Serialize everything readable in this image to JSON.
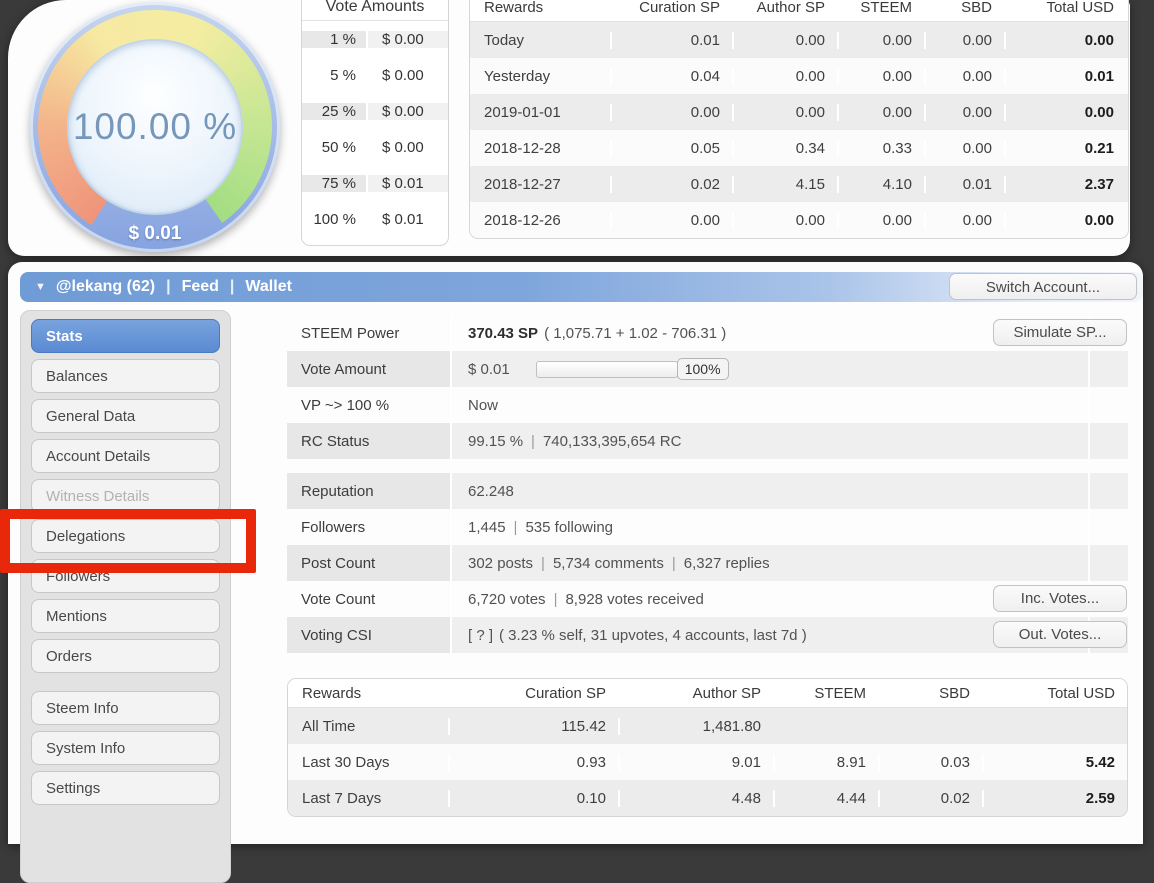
{
  "ui": {
    "sep": "|"
  },
  "gauge": {
    "percent": "100.00 %",
    "amount": "$ 0.01"
  },
  "vote_amounts": {
    "title": "Vote Amounts",
    "rows": [
      {
        "pct": "1 %",
        "value": "$ 0.00"
      },
      {
        "pct": "5 %",
        "value": "$ 0.00"
      },
      {
        "pct": "25 %",
        "value": "$ 0.00"
      },
      {
        "pct": "50 %",
        "value": "$ 0.00"
      },
      {
        "pct": "75 %",
        "value": "$ 0.01"
      },
      {
        "pct": "100 %",
        "value": "$ 0.01"
      }
    ]
  },
  "daily_rewards": {
    "headers": [
      "Rewards",
      "Curation SP",
      "Author SP",
      "STEEM",
      "SBD",
      "Total USD"
    ],
    "rows": [
      {
        "label": "Today",
        "cells": [
          "0.01",
          "0.00",
          "0.00",
          "0.00",
          "0.00"
        ]
      },
      {
        "label": "Yesterday",
        "cells": [
          "0.04",
          "0.00",
          "0.00",
          "0.00",
          "0.01"
        ]
      },
      {
        "label": "2019-01-01",
        "cells": [
          "0.00",
          "0.00",
          "0.00",
          "0.00",
          "0.00"
        ]
      },
      {
        "label": "2018-12-28",
        "cells": [
          "0.05",
          "0.34",
          "0.33",
          "0.00",
          "0.21"
        ]
      },
      {
        "label": "2018-12-27",
        "cells": [
          "0.02",
          "4.15",
          "4.10",
          "0.01",
          "2.37"
        ]
      },
      {
        "label": "2018-12-26",
        "cells": [
          "0.00",
          "0.00",
          "0.00",
          "0.00",
          "0.00"
        ]
      }
    ]
  },
  "account_bar": {
    "caret": "▼",
    "account": "@lekang (62)",
    "feed": "Feed",
    "wallet": "Wallet",
    "switch_button": "Switch Account..."
  },
  "sidebar": {
    "items": [
      {
        "label": "Stats"
      },
      {
        "label": "Balances"
      },
      {
        "label": "General Data"
      },
      {
        "label": "Account Details"
      },
      {
        "label": "Witness Details"
      },
      {
        "label": "Delegations"
      },
      {
        "label": "Followers"
      },
      {
        "label": "Mentions"
      },
      {
        "label": "Orders"
      },
      {
        "label": "Steem Info"
      },
      {
        "label": "System Info"
      },
      {
        "label": "Settings"
      }
    ]
  },
  "stats": {
    "steem_power": {
      "label": "STEEM Power",
      "value_bold": "370.43 SP",
      "value_rest": "( 1,075.71 + 1.02 - 706.31 )",
      "button": "Simulate SP..."
    },
    "vote_amount": {
      "label": "Vote Amount",
      "value": "$ 0.01",
      "slider_pct": "100%"
    },
    "vp_recharge": {
      "label": "VP ~> 100 %",
      "value": "Now"
    },
    "rc_status": {
      "label": "RC Status",
      "parts": [
        "99.15 %",
        "740,133,395,654 RC"
      ]
    },
    "reputation": {
      "label": "Reputation",
      "value": "62.248"
    },
    "followers": {
      "label": "Followers",
      "parts": [
        "1,445",
        "535 following"
      ]
    },
    "post_count": {
      "label": "Post Count",
      "parts": [
        "302 posts",
        "5,734 comments",
        "6,327 replies"
      ]
    },
    "vote_count": {
      "label": "Vote Count",
      "parts": [
        "6,720 votes",
        "8,928 votes received"
      ],
      "button": "Inc. Votes..."
    },
    "voting_csi": {
      "label": "Voting CSI",
      "help": "[ ? ]",
      "value": "( 3.23 % self, 31 upvotes, 4 accounts, last 7d )",
      "button": "Out. Votes..."
    }
  },
  "summary_rewards": {
    "headers": [
      "Rewards",
      "Curation SP",
      "Author SP",
      "STEEM",
      "SBD",
      "Total USD"
    ],
    "rows": [
      {
        "label": "All Time",
        "cells": [
          "115.42",
          "1,481.80",
          "",
          "",
          ""
        ]
      },
      {
        "label": "Last 30 Days",
        "cells": [
          "0.93",
          "9.01",
          "8.91",
          "0.03",
          "5.42"
        ]
      },
      {
        "label": "Last 7 Days",
        "cells": [
          "0.10",
          "4.48",
          "4.44",
          "0.02",
          "2.59"
        ]
      }
    ]
  },
  "colors": {
    "background": "#3a3a3a",
    "accent_blue": "#5b8ad3",
    "bar_blue": "#6f9bd6",
    "highlight_red": "#e8270b",
    "gauge_text_blue": "#7697ba"
  }
}
